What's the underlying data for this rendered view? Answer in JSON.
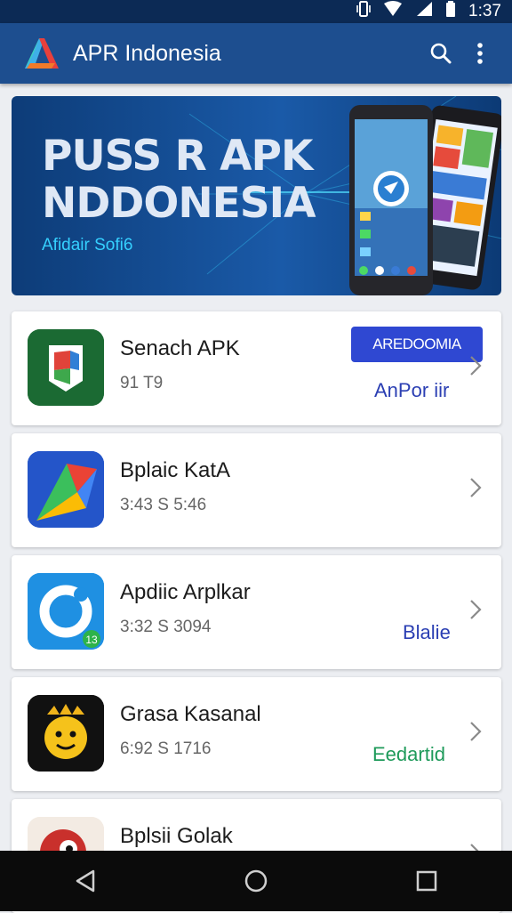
{
  "status_bar": {
    "time": "1:37"
  },
  "app_bar": {
    "title": "APR Indonesia",
    "logo_icon": "apr-logo-icon",
    "actions": [
      "search-icon",
      "more-vert-icon"
    ]
  },
  "banner": {
    "line1": "PUSS R APK",
    "line2": "NDDONESIA",
    "subtitle": "Afidair Sofi6"
  },
  "apps": [
    {
      "title": "Senach APK",
      "meta": "91 T9",
      "action_label": "AREDOOMIA",
      "sublabel": "AnPor iir",
      "sublabel_color": "#2b3fb3"
    },
    {
      "title": "Bplaic KatA",
      "meta": "3:43 S 5:46"
    },
    {
      "title": "Apdiic Arplkar",
      "meta": "3:32 S 3094",
      "sublabel": "Blalie",
      "sublabel_color": "#2b3fb3"
    },
    {
      "title": "Grasa Kasanal",
      "meta": "6:92 S 1716",
      "sublabel": "Eedartid",
      "sublabel_color": "#1e9a5a"
    },
    {
      "title": "Bplsii Golak"
    }
  ],
  "colors": {
    "status_bar": "#0c2a55",
    "app_bar": "#1d4e8f",
    "accent_button": "#2f48d2",
    "background": "#eceef2"
  }
}
